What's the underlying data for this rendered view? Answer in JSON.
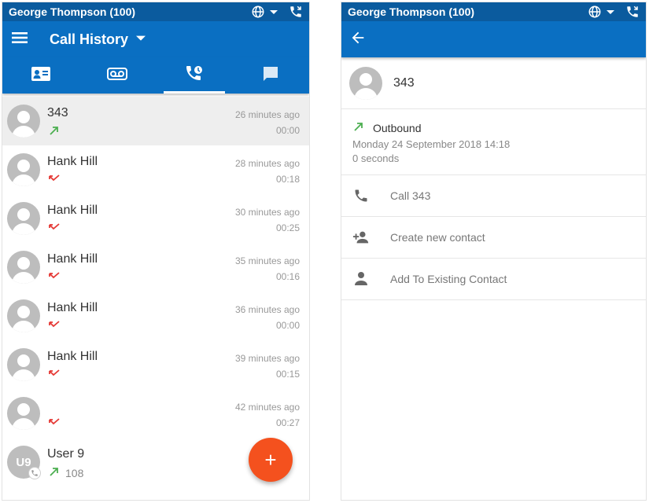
{
  "status": {
    "user": "George Thompson (100)"
  },
  "left": {
    "title": "Call History",
    "calls": [
      {
        "name": "343",
        "time": "26 minutes ago",
        "duration": "00:00",
        "direction": "outbound",
        "selected": true
      },
      {
        "name": "Hank Hill",
        "time": "28 minutes ago",
        "duration": "00:18",
        "direction": "missed"
      },
      {
        "name": "Hank Hill",
        "time": "30 minutes ago",
        "duration": "00:25",
        "direction": "missed"
      },
      {
        "name": "Hank Hill",
        "time": "35 minutes ago",
        "duration": "00:16",
        "direction": "missed"
      },
      {
        "name": "Hank Hill",
        "time": "36 minutes ago",
        "duration": "00:00",
        "direction": "missed"
      },
      {
        "name": "Hank Hill",
        "time": "39 minutes ago",
        "duration": "00:15",
        "direction": "missed"
      },
      {
        "name": "",
        "time": "42 minutes ago",
        "duration": "00:27",
        "direction": "missed"
      },
      {
        "name": "User 9",
        "initials": "U9",
        "extension": "108",
        "time": "",
        "duration": "",
        "direction": "outbound"
      }
    ],
    "fab_label": "+"
  },
  "right": {
    "contact_name": "343",
    "direction_label": "Outbound",
    "date": "Monday 24 September 2018 14:18",
    "duration": "0 seconds",
    "actions": [
      {
        "label": "Call 343",
        "icon": "phone-icon"
      },
      {
        "label": "Create new contact",
        "icon": "person-add-icon"
      },
      {
        "label": "Add To Existing Contact",
        "icon": "person-icon"
      }
    ]
  },
  "colors": {
    "header": "#0b5b9e",
    "appbar": "#0a6fc2",
    "fab": "#f4511e",
    "outbound": "#4caf50",
    "missed": "#e53935"
  }
}
